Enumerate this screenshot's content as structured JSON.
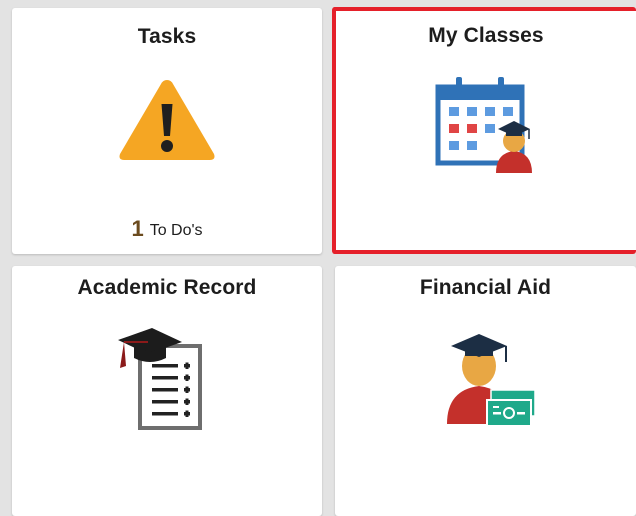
{
  "tiles": {
    "tasks": {
      "title": "Tasks",
      "count": "1",
      "count_label": "To Do's",
      "icon": "warning-icon"
    },
    "classes": {
      "title": "My Classes",
      "icon": "calendar-student-icon"
    },
    "academic": {
      "title": "Academic Record",
      "icon": "graduation-checklist-icon"
    },
    "aid": {
      "title": "Financial Aid",
      "icon": "graduate-money-icon"
    }
  },
  "colors": {
    "warning": "#f5a623",
    "selected_border": "#e5202a",
    "count": "#6b4b1e"
  }
}
